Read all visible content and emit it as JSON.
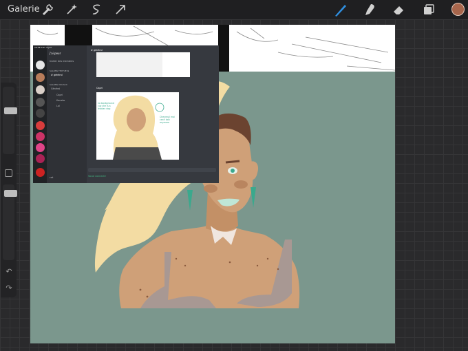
{
  "toolbar": {
    "gallery_label": "Galerie",
    "icons": [
      "wrench-icon",
      "magic-wand-icon",
      "selection-icon",
      "transform-arrow-icon",
      "brush-icon",
      "smudge-icon",
      "eraser-icon",
      "layers-icon"
    ],
    "active_tool": "brush",
    "current_color": "#a8664c"
  },
  "sidebar": {
    "size_slider_level": 0.3,
    "opacity_slider_level": 0.3,
    "modify_button": "modify-square-icon",
    "undo_icon": "undo-icon",
    "redo_icon": "redo-icon"
  },
  "reference_screenshot": {
    "status_time": "10:56",
    "status_date": "Lun. 8 juil.",
    "server_name": "j'ai peur",
    "invite_text": "Inviter des membres",
    "category_text": "SALONS TEXTUELS",
    "text_channel": "# général",
    "category_voice": "SALONS VOCAUX",
    "voice_channel": "Général",
    "voice_members": [
      "Capri",
      "Kanako",
      "Lol"
    ],
    "chat_channel": "# général",
    "message_author": "Capri",
    "note_left": "no background cuz she is a lesbian dog",
    "note_right": "Chevreuil moi can't talk anymore",
    "voice_status": "Vocal connecté",
    "user_name": "cat"
  },
  "colors": {
    "canvas_bg": "#7b978d",
    "skin": "#cfa078",
    "skin_shadow": "#b9855f",
    "hair": "#f3dca3",
    "dark_hair": "#6b4330",
    "earring": "#3aa98d",
    "top": "#a89893",
    "ui_bg": "#2a2a2c"
  }
}
